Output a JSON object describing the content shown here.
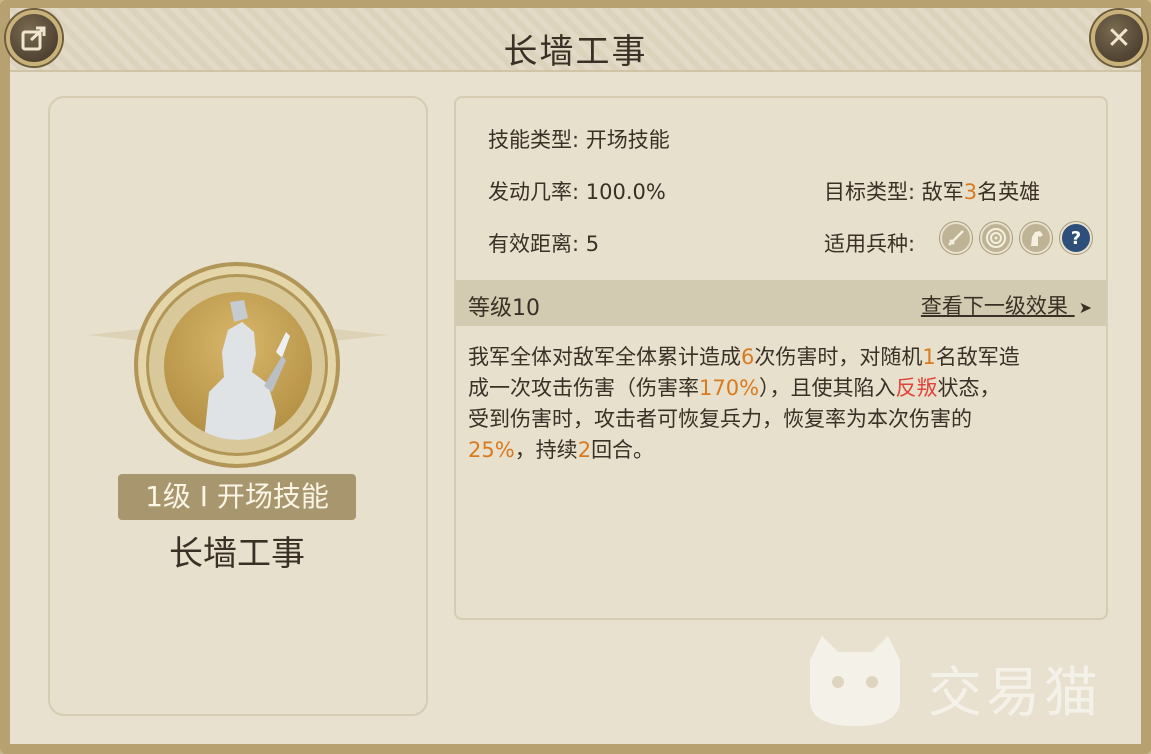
{
  "header": {
    "title": "长墙工事"
  },
  "buttons": {
    "share_icon": "share-icon",
    "close_icon": "close-icon",
    "close_glyph": "✕"
  },
  "left": {
    "level_tag": "1级 I 开场技能",
    "skill_name": "长墙工事"
  },
  "attributes": {
    "skill_type": "技能类型: 开场技能",
    "trigger_rate": "发动几率: 100.0%",
    "range": "有效距离: 5",
    "target_prefix": "目标类型: 敌军",
    "target_count": "3",
    "target_suffix": "名英雄",
    "troop_label": "适用兵种:",
    "troop_icons": [
      "sword-icon",
      "target-icon",
      "horse-icon",
      "question-icon"
    ],
    "question_glyph": "?"
  },
  "level_bar": {
    "level": "等级10",
    "next_link": "查看下一级效果",
    "arrow": "➤"
  },
  "description": {
    "l1a": "我军全体对敌军全体累计造成",
    "l1b": "6",
    "l1c": "次伤害时，对随机",
    "l1d": "1",
    "l1e": "名敌军造",
    "l2a": "成一次攻击伤害（伤害率",
    "l2b": "170%",
    "l2c": "），且使其陷入",
    "l2d": "反叛",
    "l2e": "状态，",
    "l3a": "受到伤害时，攻击者可恢复兵力，恢复率为本次伤害的",
    "l4a": "25%",
    "l4b": "，持续",
    "l4c": "2",
    "l4d": "回合。"
  },
  "watermark": {
    "text": "交易猫"
  },
  "colors": {
    "accent_orange": "#d97a1f",
    "status_red": "#e0443a",
    "frame": "#b7a170"
  }
}
